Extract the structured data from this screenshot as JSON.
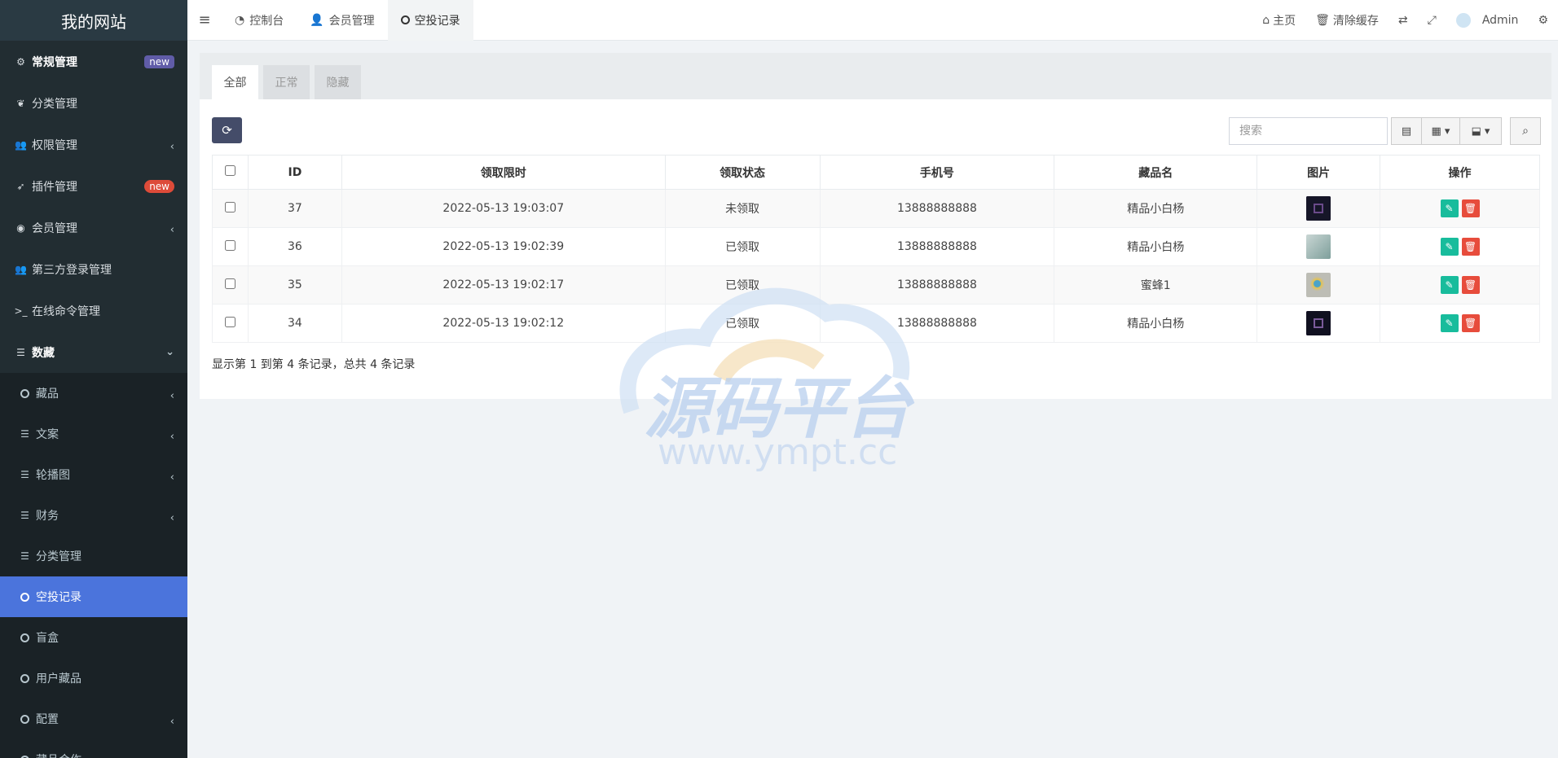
{
  "site_title": "我的网站",
  "sidebar": {
    "items": [
      {
        "label": "常规管理",
        "icon": "cogs-icon",
        "badge": "new"
      },
      {
        "label": "分类管理",
        "icon": "leaf-icon"
      },
      {
        "label": "权限管理",
        "icon": "users-icon"
      },
      {
        "label": "插件管理",
        "icon": "rocket-icon",
        "badge": "new"
      },
      {
        "label": "会员管理",
        "icon": "user-circle-icon"
      },
      {
        "label": "第三方登录管理",
        "icon": "users-icon"
      },
      {
        "label": "在线命令管理",
        "icon": "terminal-icon"
      },
      {
        "label": "数藏",
        "icon": "list-icon"
      }
    ],
    "sub_items": [
      {
        "label": "藏品",
        "icon": "circle-icon"
      },
      {
        "label": "文案",
        "icon": "list-icon"
      },
      {
        "label": "轮播图",
        "icon": "list-icon"
      },
      {
        "label": "财务",
        "icon": "list-icon"
      },
      {
        "label": "分类管理",
        "icon": "list-icon"
      },
      {
        "label": "空投记录",
        "icon": "circle-icon",
        "active": true
      },
      {
        "label": "盲盒",
        "icon": "circle-icon"
      },
      {
        "label": "用户藏品",
        "icon": "circle-icon"
      },
      {
        "label": "配置",
        "icon": "circle-icon"
      },
      {
        "label": "藏品合作",
        "icon": "circle-icon"
      }
    ]
  },
  "topbar": {
    "tabs": [
      {
        "label": "控制台",
        "icon": "dashboard-icon"
      },
      {
        "label": "会员管理",
        "icon": "user-icon"
      },
      {
        "label": "空投记录",
        "icon": "circle-icon",
        "active": true
      }
    ],
    "home": "主页",
    "clear_cache": "清除缓存",
    "user": "Admin"
  },
  "filter_tabs": [
    "全部",
    "正常",
    "隐藏"
  ],
  "search": {
    "placeholder": "搜索"
  },
  "table": {
    "columns": [
      "ID",
      "领取限时",
      "领取状态",
      "手机号",
      "藏品名",
      "图片",
      "操作"
    ],
    "rows": [
      {
        "id": "37",
        "time": "2022-05-13 19:03:07",
        "status": "未领取",
        "phone": "13888888888",
        "name": "精品小白杨",
        "img_color": "#161628"
      },
      {
        "id": "36",
        "time": "2022-05-13 19:02:39",
        "status": "已领取",
        "phone": "13888888888",
        "name": "精品小白杨",
        "img_color": "#9fb7b4"
      },
      {
        "id": "35",
        "time": "2022-05-13 19:02:17",
        "status": "已领取",
        "phone": "13888888888",
        "name": "蜜蜂1",
        "img_color": "#bdbdb5"
      },
      {
        "id": "34",
        "time": "2022-05-13 19:02:12",
        "status": "已领取",
        "phone": "13888888888",
        "name": "精品小白杨",
        "img_color": "#101020"
      }
    ]
  },
  "page_info": "显示第 1 到第 4 条记录，总共 4 条记录",
  "watermark": {
    "main": "源码平台",
    "url": "www.ympt.cc"
  },
  "colors": {
    "sidebar": "#222d32",
    "active": "#4b74dc",
    "green": "#18bc9c",
    "red": "#e74c3c"
  }
}
